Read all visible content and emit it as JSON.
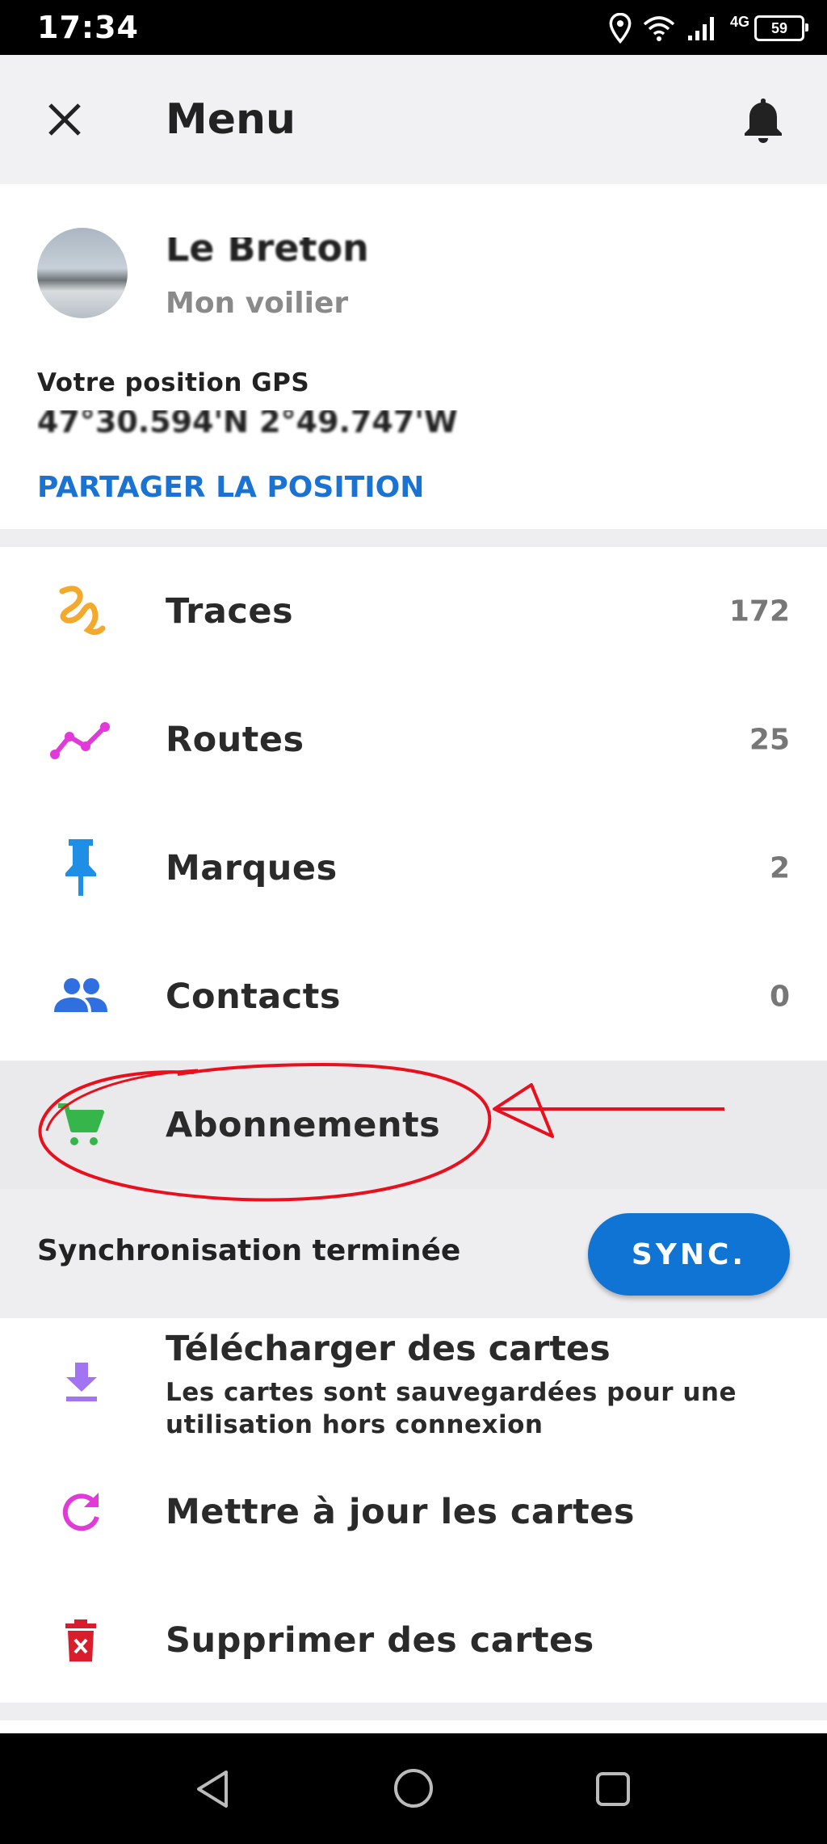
{
  "status_bar": {
    "time": "17:34",
    "network": "4G",
    "battery": "59"
  },
  "header": {
    "title": "Menu"
  },
  "profile": {
    "name": "Le Breton",
    "boat": "Mon voilier",
    "gps_label": "Votre position GPS",
    "gps_value": "47°30.594'N  2°49.747'W",
    "share_label": "PARTAGER LA POSITION"
  },
  "menu": [
    {
      "label": "Traces",
      "count": "172",
      "icon": "traces-icon",
      "color": "#f4a92c"
    },
    {
      "label": "Routes",
      "count": "25",
      "icon": "routes-icon",
      "color": "#e23ad8"
    },
    {
      "label": "Marques",
      "count": "2",
      "icon": "pin-icon",
      "color": "#1f8fe6"
    },
    {
      "label": "Contacts",
      "count": "0",
      "icon": "contacts-icon",
      "color": "#2f6fe0"
    },
    {
      "label": "Abonnements",
      "count": "",
      "icon": "cart-icon",
      "color": "#35b54a"
    }
  ],
  "sync": {
    "status": "Synchronisation terminée",
    "button": "SYNC."
  },
  "maps": {
    "download_title": "Télécharger des cartes",
    "download_subtitle": "Les cartes sont sauvegardées pour une utilisation hors connexion",
    "update_label": "Mettre à jour les cartes",
    "delete_label": "Supprimer des cartes"
  },
  "colors": {
    "accent": "#0f74d4",
    "annotation": "#e8101c"
  }
}
